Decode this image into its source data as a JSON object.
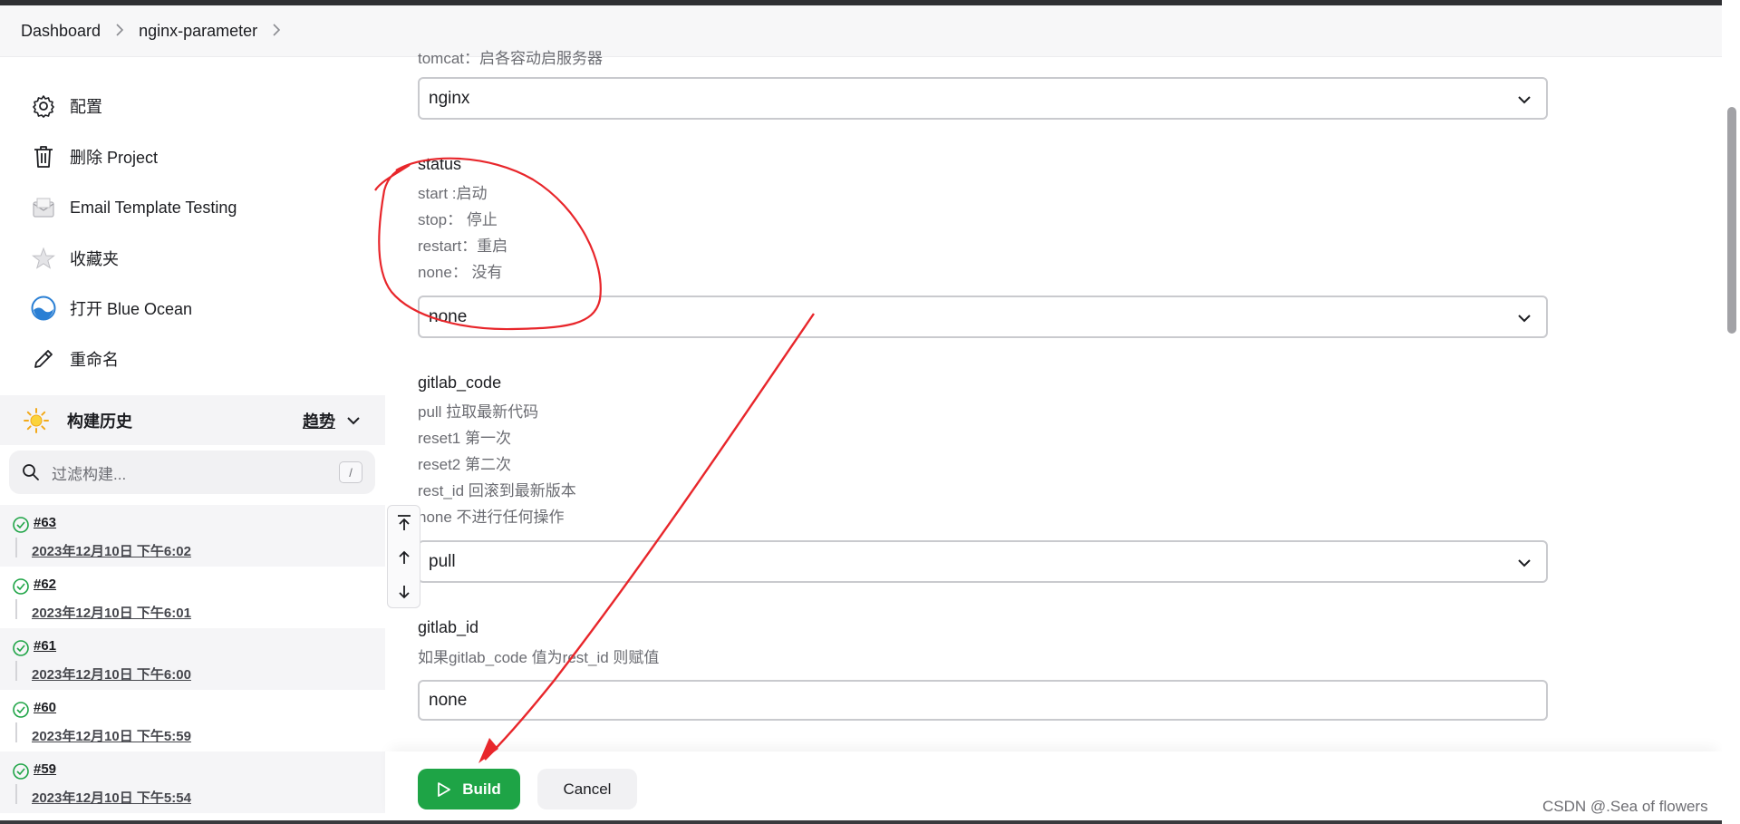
{
  "breadcrumb": {
    "items": [
      "Dashboard",
      "nginx-parameter"
    ]
  },
  "sidebar": {
    "tasks": [
      {
        "label": "配置",
        "icon": "gear-icon"
      },
      {
        "label": "删除 Project",
        "icon": "trash-icon"
      },
      {
        "label": "Email Template Testing",
        "icon": "envelope-icon"
      },
      {
        "label": "收藏夹",
        "icon": "star-icon"
      },
      {
        "label": "打开 Blue Ocean",
        "icon": "blue-ocean-icon"
      },
      {
        "label": "重命名",
        "icon": "pencil-icon"
      }
    ],
    "history": {
      "title": "构建历史",
      "trend": "趋势",
      "filter_placeholder": "过滤构建...",
      "filter_key": "/",
      "builds": [
        {
          "number": "#63",
          "date": "2023年12月10日 下午6:02"
        },
        {
          "number": "#62",
          "date": "2023年12月10日 下午6:01"
        },
        {
          "number": "#61",
          "date": "2023年12月10日 下午6:00"
        },
        {
          "number": "#60",
          "date": "2023年12月10日 下午5:59"
        },
        {
          "number": "#59",
          "date": "2023年12月10日 下午5:54"
        }
      ]
    }
  },
  "form": {
    "prev_desc_cut": "tomcat：启各容动启服务器",
    "server_value": "nginx",
    "status": {
      "label": "status",
      "desc": [
        "start :启动",
        "stop： 停止",
        "restart：重启",
        "none： 没有"
      ],
      "value": "none"
    },
    "gitlab_code": {
      "label": "gitlab_code",
      "desc": [
        "pull  拉取最新代码",
        "reset1  第一次",
        "reset2  第二次",
        "rest_id  回滚到最新版本",
        "none   不进行任何操作"
      ],
      "value": "pull"
    },
    "gitlab_id": {
      "label": "gitlab_id",
      "desc": "如果gitlab_code 值为rest_id 则赋值",
      "value": "none"
    }
  },
  "footer": {
    "build_label": "Build",
    "cancel_label": "Cancel"
  },
  "watermark": "CSDN @.Sea of flowers",
  "colors": {
    "accent_green": "#1ea446",
    "annotation_red": "#e8262b"
  }
}
